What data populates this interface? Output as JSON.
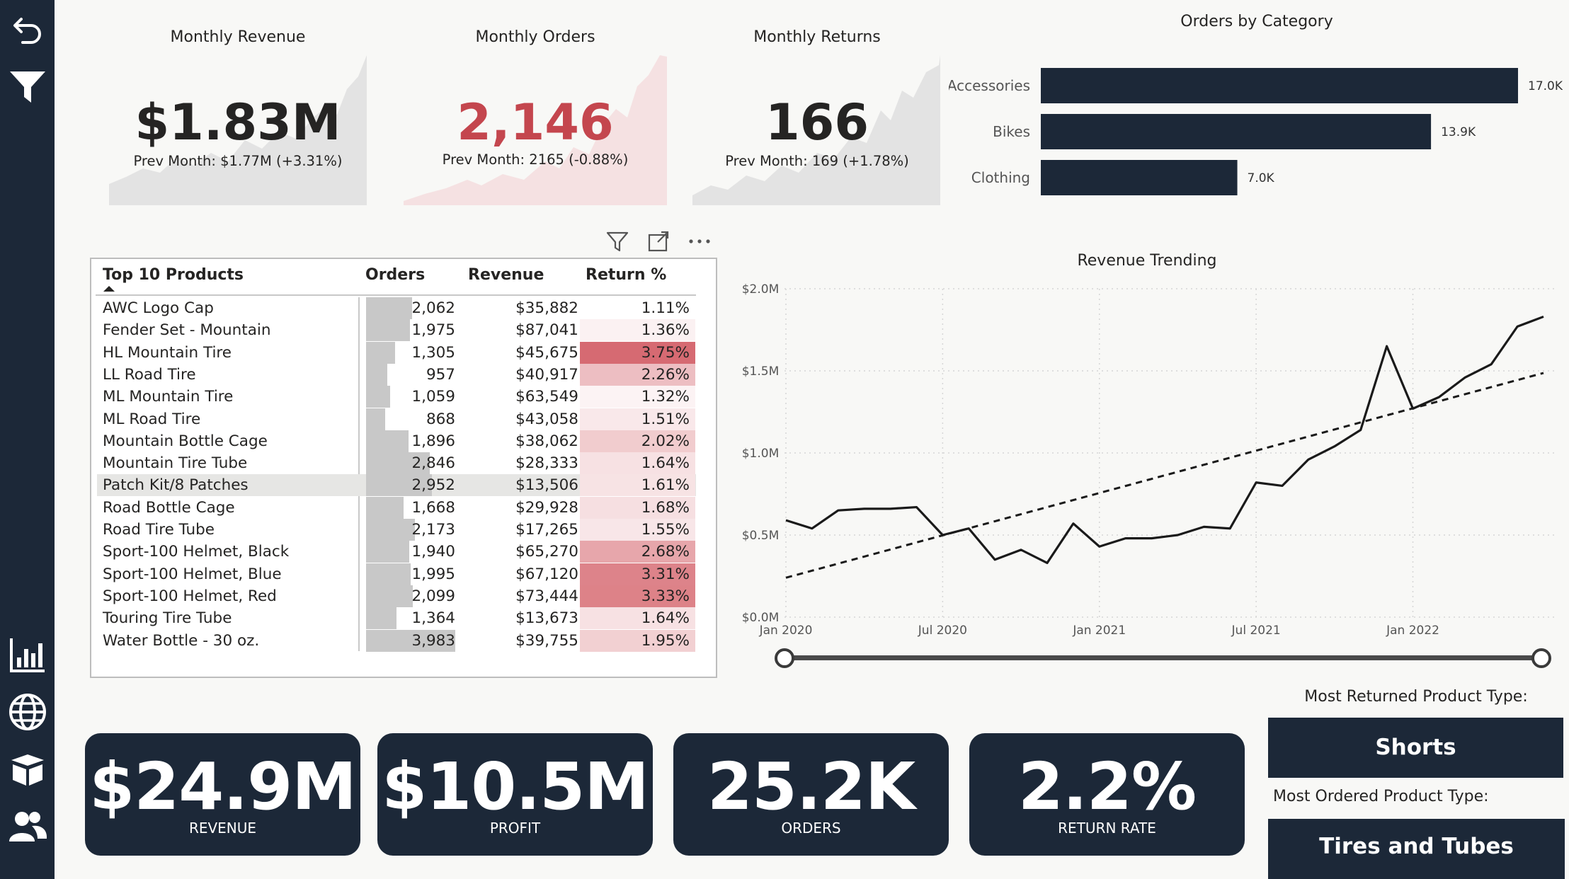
{
  "sidebar": {
    "items": [
      {
        "icon": "back-arrow-icon"
      },
      {
        "icon": "filter-icon"
      },
      {
        "icon": "bar-chart-icon"
      },
      {
        "icon": "globe-icon"
      },
      {
        "icon": "open-box-icon"
      },
      {
        "icon": "people-icon"
      }
    ]
  },
  "kpis": {
    "revenue": {
      "title": "Monthly Revenue",
      "value": "$1.83M",
      "prev": "Prev Month: $1.77M (+3.31%)",
      "color": "#252423"
    },
    "orders": {
      "title": "Monthly Orders",
      "value": "2,146",
      "prev": "Prev Month: 2165 (-0.88%)",
      "color": "#c4464e"
    },
    "returns": {
      "title": "Monthly Returns",
      "value": "166",
      "prev": "Prev Month: 169 (+1.78%)",
      "color": "#252423"
    }
  },
  "category_chart": {
    "title": "Orders by Category",
    "bars": [
      {
        "label": "Accessories",
        "value_label": "17.0K"
      },
      {
        "label": "Bikes",
        "value_label": "13.9K"
      },
      {
        "label": "Clothing",
        "value_label": "7.0K"
      }
    ]
  },
  "table": {
    "headers": {
      "product": "Top 10 Products",
      "orders": "Orders",
      "revenue": "Revenue",
      "return": "Return %"
    },
    "rows": [
      {
        "name": "AWC Logo Cap",
        "orders": "2,062",
        "revenue": "$35,882",
        "ret": "1.11%"
      },
      {
        "name": "Fender Set - Mountain",
        "orders": "1,975",
        "revenue": "$87,041",
        "ret": "1.36%"
      },
      {
        "name": "HL Mountain Tire",
        "orders": "1,305",
        "revenue": "$45,675",
        "ret": "3.75%"
      },
      {
        "name": "LL Road Tire",
        "orders": "957",
        "revenue": "$40,917",
        "ret": "2.26%"
      },
      {
        "name": "ML Mountain Tire",
        "orders": "1,059",
        "revenue": "$63,549",
        "ret": "1.32%"
      },
      {
        "name": "ML Road Tire",
        "orders": "868",
        "revenue": "$43,058",
        "ret": "1.51%"
      },
      {
        "name": "Mountain Bottle Cage",
        "orders": "1,896",
        "revenue": "$38,062",
        "ret": "2.02%"
      },
      {
        "name": "Mountain Tire Tube",
        "orders": "2,846",
        "revenue": "$28,333",
        "ret": "1.64%"
      },
      {
        "name": "Patch Kit/8 Patches",
        "orders": "2,952",
        "revenue": "$13,506",
        "ret": "1.61%"
      },
      {
        "name": "Road Bottle Cage",
        "orders": "1,668",
        "revenue": "$29,928",
        "ret": "1.68%"
      },
      {
        "name": "Road Tire Tube",
        "orders": "2,173",
        "revenue": "$17,265",
        "ret": "1.55%"
      },
      {
        "name": "Sport-100 Helmet, Black",
        "orders": "1,940",
        "revenue": "$65,270",
        "ret": "2.68%"
      },
      {
        "name": "Sport-100 Helmet, Blue",
        "orders": "1,995",
        "revenue": "$67,120",
        "ret": "3.31%"
      },
      {
        "name": "Sport-100 Helmet, Red",
        "orders": "2,099",
        "revenue": "$73,444",
        "ret": "3.33%"
      },
      {
        "name": "Touring Tire Tube",
        "orders": "1,364",
        "revenue": "$13,673",
        "ret": "1.64%"
      },
      {
        "name": "Water Bottle - 30 oz.",
        "orders": "3,983",
        "revenue": "$39,755",
        "ret": "1.95%"
      }
    ]
  },
  "trend_chart": {
    "title": "Revenue Trending",
    "y_ticks": [
      "$2.0M",
      "$1.5M",
      "$1.0M",
      "$0.5M",
      "$0.0M"
    ],
    "x_ticks": [
      "Jan 2020",
      "Jul 2020",
      "Jan 2021",
      "Jul 2021",
      "Jan 2022"
    ]
  },
  "tiles": [
    {
      "value": "$24.9M",
      "label": "REVENUE"
    },
    {
      "value": "$10.5M",
      "label": "PROFIT"
    },
    {
      "value": "25.2K",
      "label": "ORDERS"
    },
    {
      "value": "2.2%",
      "label": "RETURN RATE"
    }
  ],
  "insights": {
    "returned_label": "Most Returned Product Type:",
    "returned_value": "Shorts",
    "ordered_label": "Most Ordered Product Type:",
    "ordered_value": "Tires and Tubes"
  },
  "chart_data": [
    {
      "type": "bar",
      "title": "Orders by Category",
      "orientation": "horizontal",
      "categories": [
        "Accessories",
        "Bikes",
        "Clothing"
      ],
      "values": [
        17000,
        13900,
        7000
      ]
    },
    {
      "type": "line",
      "title": "Revenue Trending",
      "x": [
        "2020-01",
        "2020-02",
        "2020-03",
        "2020-04",
        "2020-05",
        "2020-06",
        "2020-07",
        "2020-08",
        "2020-09",
        "2020-10",
        "2020-11",
        "2020-12",
        "2021-01",
        "2021-02",
        "2021-03",
        "2021-04",
        "2021-05",
        "2021-06",
        "2021-07",
        "2021-08",
        "2021-09",
        "2021-10",
        "2021-11",
        "2021-12",
        "2022-01",
        "2022-02",
        "2022-03",
        "2022-04",
        "2022-05",
        "2022-06"
      ],
      "series": [
        {
          "values": [
            0.59,
            0.54,
            0.65,
            0.66,
            0.66,
            0.67,
            0.5,
            0.54,
            0.35,
            0.41,
            0.33,
            0.57,
            0.43,
            0.48,
            0.48,
            0.5,
            0.55,
            0.54,
            0.82,
            0.8,
            0.96,
            1.04,
            1.14,
            1.65,
            1.27,
            1.34,
            1.46,
            1.54,
            1.77,
            1.83
          ]
        },
        {
          "values": [
            0.24,
            0.283,
            0.326,
            0.369,
            0.412,
            0.455,
            0.498,
            0.541,
            0.584,
            0.627,
            0.67,
            0.713,
            0.756,
            0.799,
            0.842,
            0.885,
            0.928,
            0.971,
            1.014,
            1.057,
            1.1,
            1.143,
            1.186,
            1.229,
            1.272,
            1.315,
            1.358,
            1.401,
            1.444,
            1.487
          ]
        }
      ],
      "ylim": [
        0,
        2.0
      ],
      "yunit": "$M"
    }
  ]
}
